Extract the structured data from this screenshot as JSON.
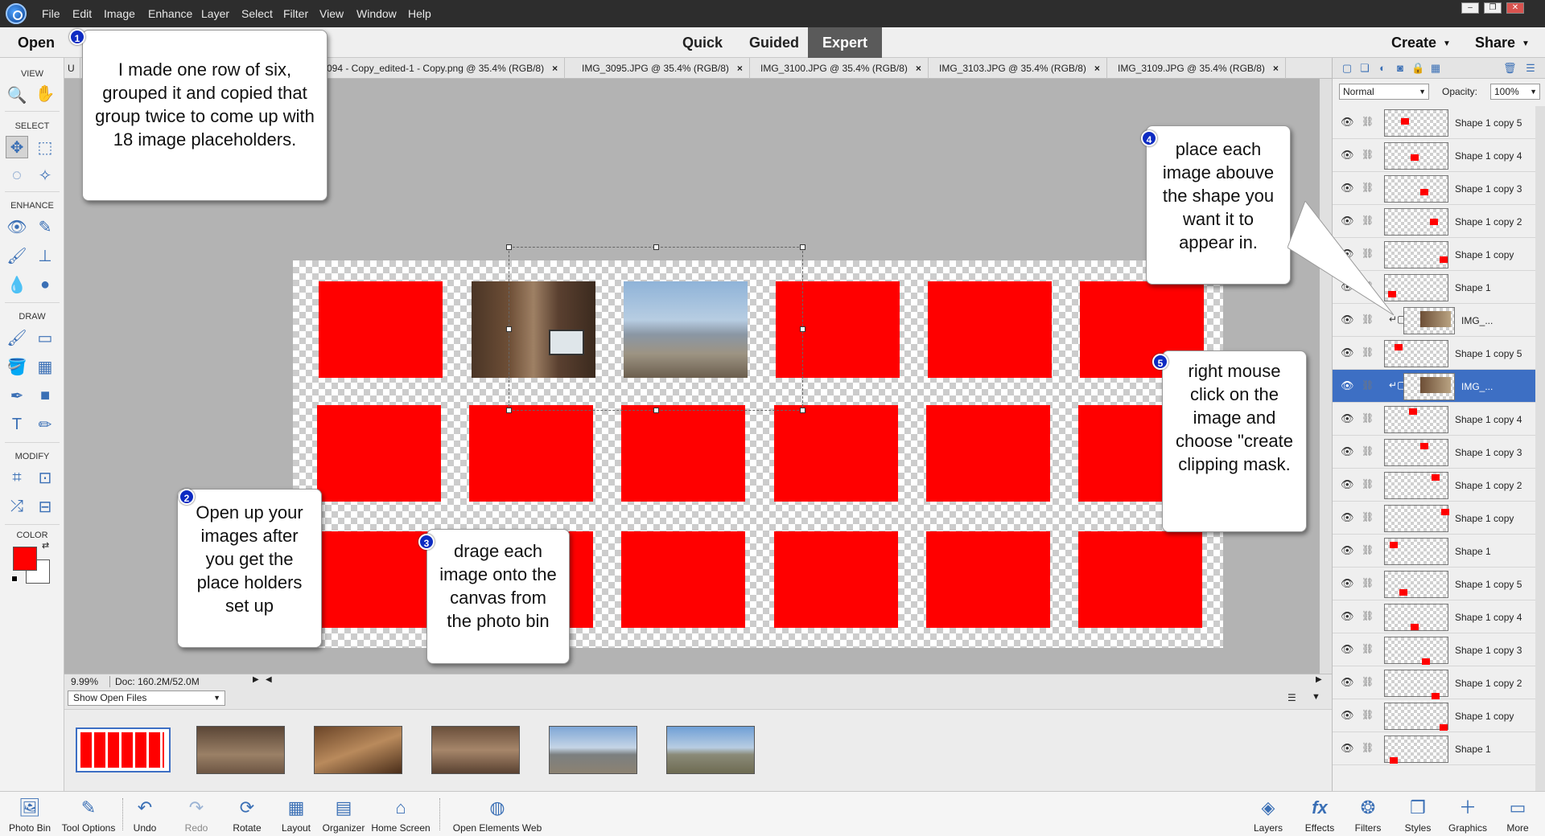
{
  "menubar": {
    "items": [
      "File",
      "Edit",
      "Image",
      "Enhance",
      "Layer",
      "Select",
      "Filter",
      "View",
      "Window",
      "Help"
    ]
  },
  "modebar": {
    "open_label": "Open",
    "modes": [
      "Quick",
      "Guided",
      "Expert"
    ],
    "active_mode": "Expert",
    "create_label": "Create",
    "share_label": "Share"
  },
  "toolbox": {
    "sections": [
      "VIEW",
      "SELECT",
      "ENHANCE",
      "DRAW",
      "MODIFY",
      "COLOR"
    ],
    "foreground_color": "#ff0000",
    "background_color": "#ffffff"
  },
  "doc_tabs": [
    {
      "label": "U"
    },
    {
      "label": "094 - Copy_edited-1 - Copy.png @ 35.4% (RGB/8)"
    },
    {
      "label": "IMG_3095.JPG @ 35.4% (RGB/8)"
    },
    {
      "label": "IMG_3100.JPG @ 35.4% (RGB/8)"
    },
    {
      "label": "IMG_3103.JPG @ 35.4% (RGB/8)"
    },
    {
      "label": "IMG_3109.JPG @ 35.4% (RGB/8)"
    }
  ],
  "statusbar": {
    "zoom": "9.99%",
    "doc_size": "Doc: 160.2M/52.0M"
  },
  "bin": {
    "dropdown_value": "Show Open Files"
  },
  "taskbar": {
    "left": [
      "Photo Bin",
      "Tool Options",
      "Undo",
      "Redo",
      "Rotate",
      "Layout",
      "Organizer",
      "Home Screen",
      "Open Elements Web"
    ],
    "right": [
      "Layers",
      "Effects",
      "Filters",
      "Styles",
      "Graphics",
      "More"
    ]
  },
  "layers_panel": {
    "blend_mode": "Normal",
    "opacity_label": "Opacity:",
    "opacity_value": "100%",
    "layers": [
      {
        "name": "Shape 1 copy 5",
        "type": "shape"
      },
      {
        "name": "Shape 1 copy 4",
        "type": "shape"
      },
      {
        "name": "Shape 1 copy 3",
        "type": "shape"
      },
      {
        "name": "Shape 1 copy 2",
        "type": "shape"
      },
      {
        "name": "Shape 1 copy",
        "type": "shape"
      },
      {
        "name": "Shape 1",
        "type": "shape"
      },
      {
        "name": "IMG_...",
        "type": "image"
      },
      {
        "name": "Shape 1 copy 5",
        "type": "shape"
      },
      {
        "name": "IMG_...",
        "type": "image",
        "selected": true
      },
      {
        "name": "Shape 1 copy 4",
        "type": "shape"
      },
      {
        "name": "Shape 1 copy 3",
        "type": "shape"
      },
      {
        "name": "Shape 1 copy 2",
        "type": "shape"
      },
      {
        "name": "Shape 1 copy",
        "type": "shape"
      },
      {
        "name": "Shape 1",
        "type": "shape"
      },
      {
        "name": "Shape 1 copy 5",
        "type": "shape"
      },
      {
        "name": "Shape 1 copy 4",
        "type": "shape"
      },
      {
        "name": "Shape 1 copy 3",
        "type": "shape"
      },
      {
        "name": "Shape 1 copy 2",
        "type": "shape"
      },
      {
        "name": "Shape 1 copy",
        "type": "shape"
      },
      {
        "name": "Shape 1",
        "type": "shape"
      }
    ]
  },
  "callouts": [
    {
      "num": "1",
      "text": "I made one row of six, grouped it and copied that group twice to come up with 18 image placeholders."
    },
    {
      "num": "2",
      "text": "Open up your images after you get the place holders set up"
    },
    {
      "num": "3",
      "text": "drage each image onto the canvas from the photo bin"
    },
    {
      "num": "4",
      "text": "place each image abouve the shape you want it to appear in."
    },
    {
      "num": "5",
      "text": "right mouse click on the image and choose \"create clipping mask."
    }
  ]
}
